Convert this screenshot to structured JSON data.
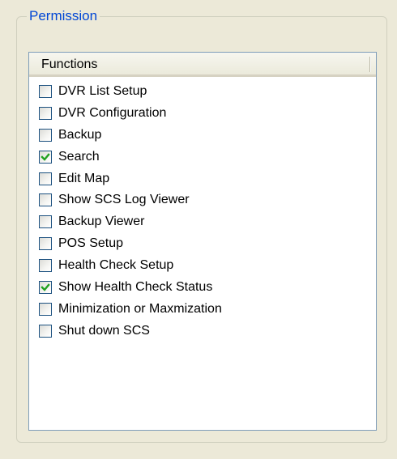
{
  "group": {
    "title": "Permission"
  },
  "list": {
    "header": "Functions",
    "items": [
      {
        "label": "DVR List Setup",
        "checked": false
      },
      {
        "label": "DVR Configuration",
        "checked": false
      },
      {
        "label": "Backup",
        "checked": false
      },
      {
        "label": "Search",
        "checked": true
      },
      {
        "label": "Edit Map",
        "checked": false
      },
      {
        "label": "Show SCS Log Viewer",
        "checked": false
      },
      {
        "label": "Backup Viewer",
        "checked": false
      },
      {
        "label": "POS Setup",
        "checked": false
      },
      {
        "label": "Health Check Setup",
        "checked": false
      },
      {
        "label": "Show Health Check Status",
        "checked": true
      },
      {
        "label": "Minimization or Maxmization",
        "checked": false
      },
      {
        "label": "Shut down SCS",
        "checked": false
      }
    ]
  },
  "colors": {
    "background": "#ece9d8",
    "legend_text": "#0046d5",
    "checkmark": "#21a121",
    "checkbox_border": "#1c5180"
  },
  "icons": {
    "checkmark": "check-icon"
  }
}
